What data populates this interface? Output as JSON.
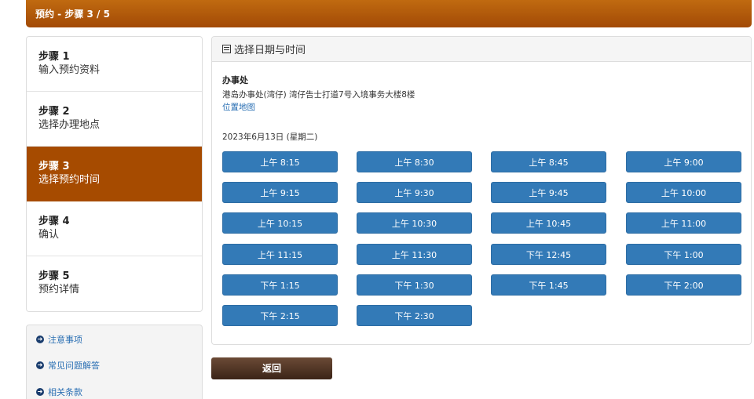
{
  "header": {
    "title": "预约 - 步骤 3 / 5"
  },
  "steps": [
    {
      "num": "步骤 1",
      "name": "输入预约资料",
      "active": false
    },
    {
      "num": "步骤 2",
      "name": "选择办理地点",
      "active": false
    },
    {
      "num": "步骤 3",
      "name": "选择预约时间",
      "active": true
    },
    {
      "num": "步骤 4",
      "name": "确认",
      "active": false
    },
    {
      "num": "步骤 5",
      "name": "预约详情",
      "active": false
    }
  ],
  "links": [
    "注意事项",
    "常见问题解答",
    "相关条款"
  ],
  "panel": {
    "title": "选择日期与时间",
    "office_label": "办事处",
    "office_address": "港岛办事处(湾仔) 湾仔告士打道7号入境事务大楼8楼",
    "map_link": "位置地图",
    "date": "2023年6月13日 (星期二)"
  },
  "time_slots": [
    "上午 8:15",
    "上午 8:30",
    "上午 8:45",
    "上午 9:00",
    "上午 9:15",
    "上午 9:30",
    "上午 9:45",
    "上午 10:00",
    "上午 10:15",
    "上午 10:30",
    "上午 10:45",
    "上午 11:00",
    "上午 11:15",
    "上午 11:30",
    "下午 12:45",
    "下午 1:00",
    "下午 1:15",
    "下午 1:30",
    "下午 1:45",
    "下午 2:00",
    "下午 2:15",
    "下午 2:30"
  ],
  "buttons": {
    "back": "返回"
  },
  "colors": {
    "header": "#a64b00",
    "active_step": "#a64b00",
    "slot": "#337ab7",
    "back": "#4a2e1f"
  }
}
